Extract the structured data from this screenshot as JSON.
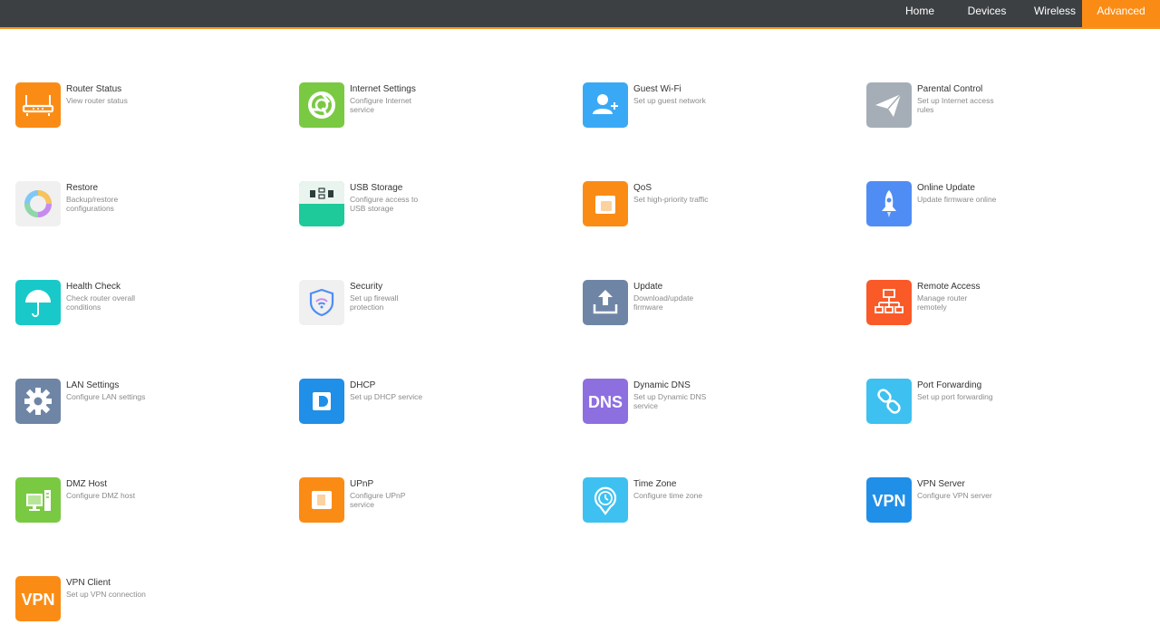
{
  "nav": {
    "items": [
      "Home",
      "Devices",
      "Wireless",
      "Advanced"
    ],
    "active": "Advanced",
    "accent": "#fa8c16"
  },
  "tiles": [
    {
      "title": "Router Status",
      "desc": "View router status",
      "icon": "router-icon",
      "color": "#fa8c16"
    },
    {
      "title": "Internet Settings",
      "desc": "Configure Internet service",
      "icon": "internet-icon",
      "color": "#7ac943"
    },
    {
      "title": "Guest Wi-Fi",
      "desc": "Set up guest network",
      "icon": "guest-user-icon",
      "color": "#3aa9f5"
    },
    {
      "title": "Parental Control",
      "desc": "Set up Internet access rules",
      "icon": "paper-plane-icon",
      "color": "#a5aeb6"
    },
    {
      "title": "Restore",
      "desc": "Backup/restore configurations",
      "icon": "restore-ring-icon",
      "color": "#f0f0f0"
    },
    {
      "title": "USB Storage",
      "desc": "Configure access to USB storage",
      "icon": "usb-icon",
      "color": "#1ec99a"
    },
    {
      "title": "QoS",
      "desc": "Set high-priority traffic",
      "icon": "qos-icon",
      "color": "#fa8c16"
    },
    {
      "title": "Online Update",
      "desc": "Update firmware online",
      "icon": "rocket-icon",
      "color": "#4f8df5"
    },
    {
      "title": "Health Check",
      "desc": "Check router overall conditions",
      "icon": "umbrella-icon",
      "color": "#19c9c9"
    },
    {
      "title": "Security",
      "desc": "Set up firewall protection",
      "icon": "shield-wifi-icon",
      "color": "#f0f0f0"
    },
    {
      "title": "Update",
      "desc": "Download/update firmware",
      "icon": "upload-icon",
      "color": "#6f85a6"
    },
    {
      "title": "Remote Access",
      "desc": "Manage router remotely",
      "icon": "network-icon",
      "color": "#fa5a28"
    },
    {
      "title": "LAN Settings",
      "desc": "Configure LAN settings",
      "icon": "gear-icon",
      "color": "#6f85a6"
    },
    {
      "title": "DHCP",
      "desc": "Set up DHCP service",
      "icon": "dhcp-icon",
      "color": "#1f8fe8"
    },
    {
      "title": "Dynamic DNS",
      "desc": "Set up Dynamic DNS service",
      "icon": "dns-icon",
      "color": "#8e6fe0"
    },
    {
      "title": "Port Forwarding",
      "desc": "Set up port forwarding",
      "icon": "link-icon",
      "color": "#3ec1f0"
    },
    {
      "title": "DMZ Host",
      "desc": "Configure DMZ host",
      "icon": "computer-icon",
      "color": "#7ac943"
    },
    {
      "title": "UPnP",
      "desc": "Configure UPnP service",
      "icon": "upnp-icon",
      "color": "#fa8c16"
    },
    {
      "title": "Time Zone",
      "desc": "Configure time zone",
      "icon": "clock-pin-icon",
      "color": "#3ec1f0"
    },
    {
      "title": "VPN Server",
      "desc": "Configure VPN server",
      "icon": "vpn-icon",
      "color": "#1f8fe8"
    },
    {
      "title": "VPN Client",
      "desc": "Set up VPN connection",
      "icon": "vpn-icon",
      "color": "#fa8c16"
    }
  ],
  "icon_text": {
    "dns": "DNS",
    "vpn": "VPN"
  }
}
